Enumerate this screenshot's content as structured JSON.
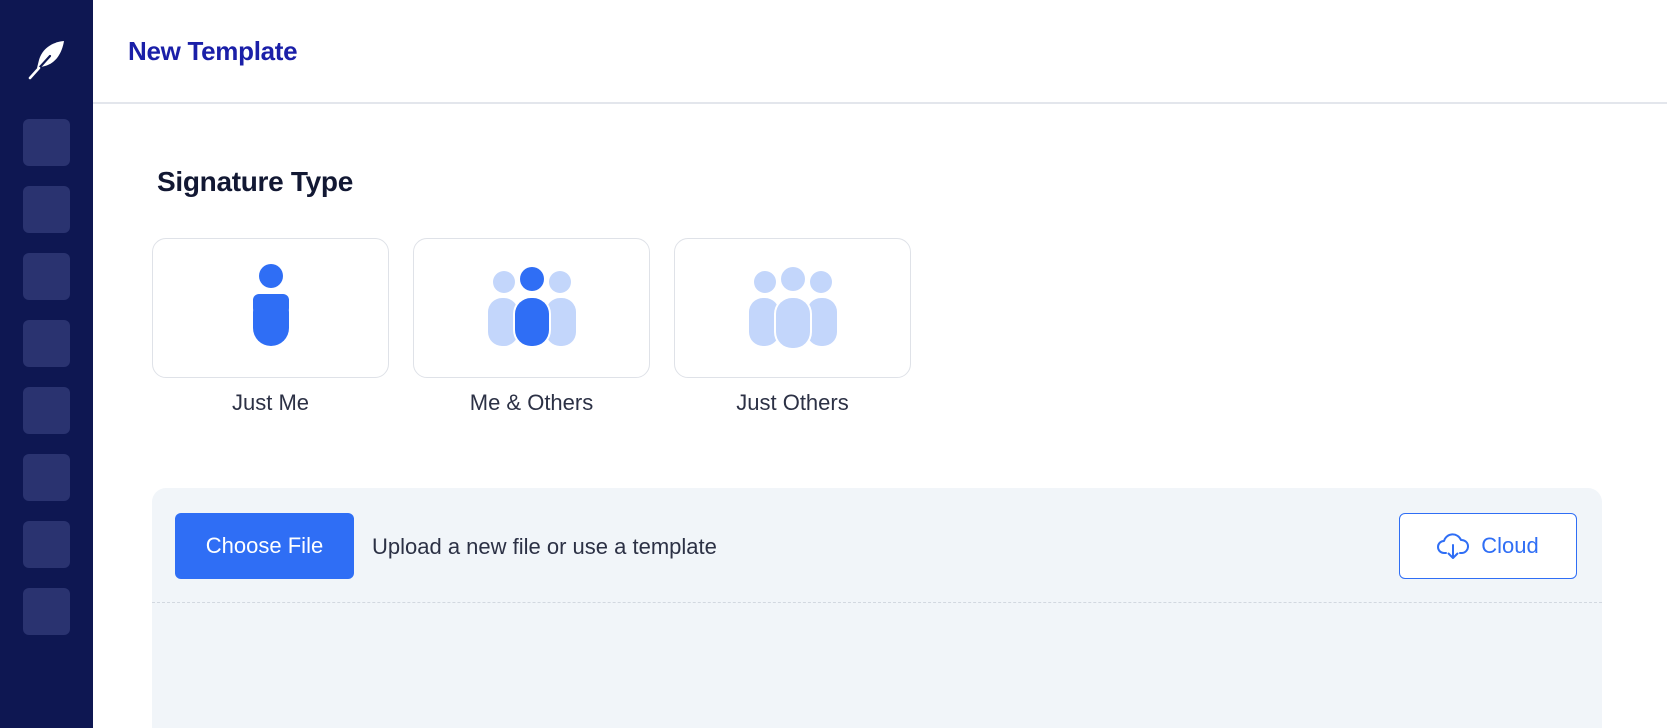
{
  "header": {
    "title": "New Template"
  },
  "sidebar": {
    "logo_icon": "feather-icon",
    "nav_count": 8
  },
  "signature": {
    "title": "Signature Type",
    "options": [
      {
        "label": "Just Me",
        "icon": "single-person-icon"
      },
      {
        "label": "Me & Others",
        "icon": "group-highlight-icon"
      },
      {
        "label": "Just Others",
        "icon": "group-icon"
      }
    ]
  },
  "upload": {
    "choose_label": "Choose File",
    "hint": "Upload a new file or use a template",
    "cloud_label": "Cloud",
    "cloud_icon": "cloud-download-icon"
  },
  "colors": {
    "sidebar": "#0e1752",
    "accent": "#2f6ef5",
    "accent_light": "#c3d6fb",
    "title": "#1a1fa8"
  }
}
